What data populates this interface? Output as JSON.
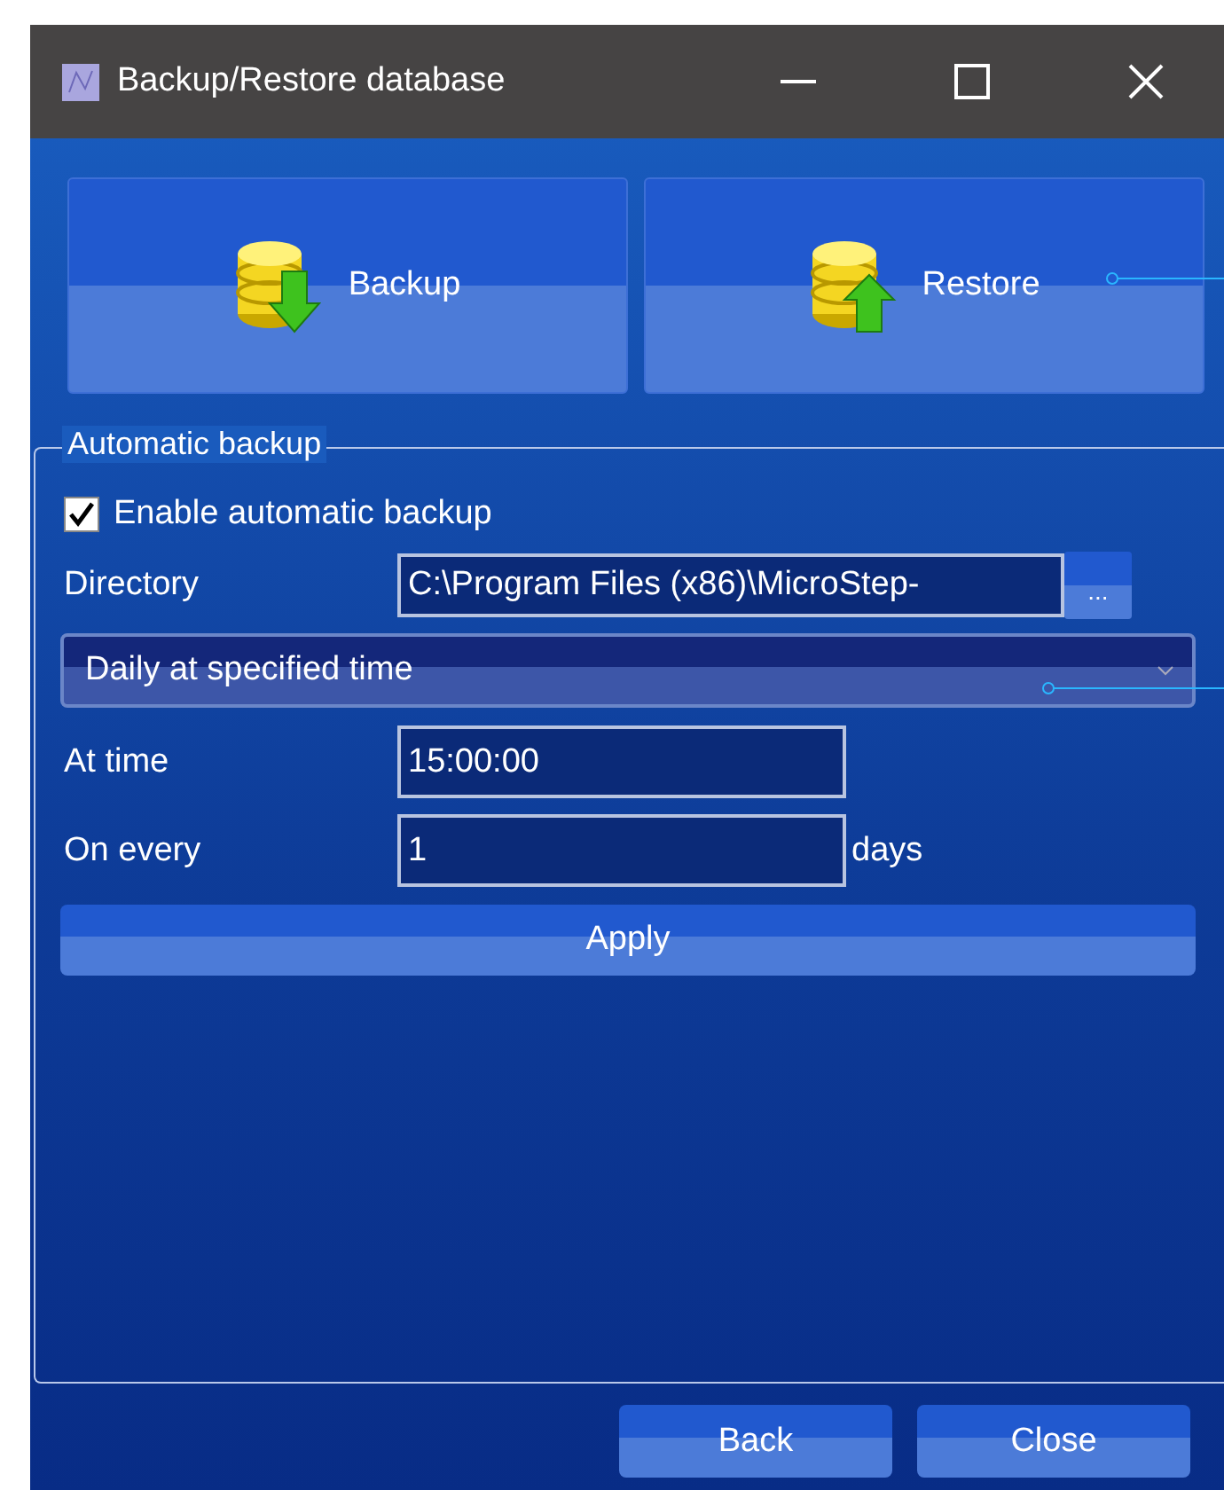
{
  "window": {
    "title": "Backup/Restore database"
  },
  "actions": [
    {
      "label": "Backup",
      "kind": "down"
    },
    {
      "label": "Restore",
      "kind": "up"
    }
  ],
  "group": {
    "title": "Automatic backup",
    "enable": {
      "label": "Enable automatic backup",
      "checked": true
    },
    "directory": {
      "label": "Directory",
      "value": "C:\\Program Files (x86)\\MicroStep-",
      "browse": "..."
    },
    "schedule": {
      "value": "Daily at specified time"
    },
    "at_time": {
      "label": "At time",
      "value": "15:00:00"
    },
    "on_every": {
      "label": "On every",
      "value": "1",
      "unit": "days"
    },
    "apply": "Apply"
  },
  "footer_buttons": [
    "Back",
    "Close"
  ]
}
